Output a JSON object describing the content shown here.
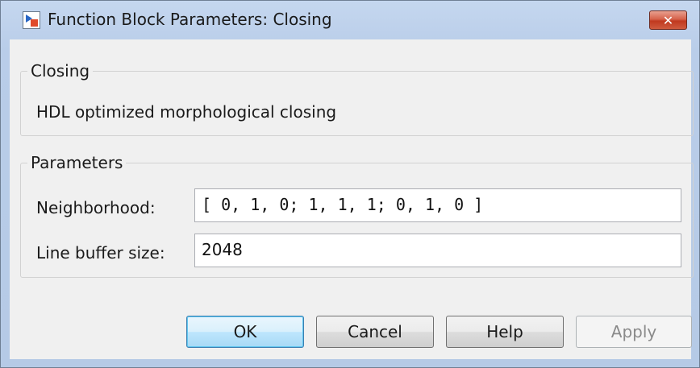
{
  "window": {
    "title": "Function Block Parameters: Closing",
    "close_glyph": "✕",
    "app_icon": "simulink-block-icon",
    "close_color": "#c9452c"
  },
  "group_block": {
    "legend": "Closing",
    "description": "HDL optimized morphological closing"
  },
  "group_params": {
    "legend": "Parameters",
    "neighborhood_label": "Neighborhood:",
    "neighborhood_value": "[ 0, 1, 0; 1, 1, 1; 0, 1, 0 ]",
    "line_buffer_label": "Line buffer size:",
    "line_buffer_value": "2048"
  },
  "buttons": {
    "ok": "OK",
    "cancel": "Cancel",
    "help": "Help",
    "apply": "Apply",
    "apply_enabled": false
  }
}
